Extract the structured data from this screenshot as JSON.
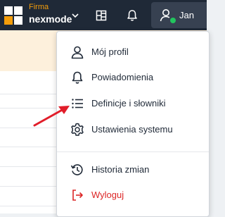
{
  "header": {
    "brand_small": "Firma",
    "brand_name": "nexmode",
    "user_name": "Jan",
    "colors": {
      "bar": "#1f2937",
      "brand_accent": "#f59e0b",
      "online": "#22c55e"
    }
  },
  "menu": {
    "items": [
      {
        "label": "Mój profil",
        "icon": "user-icon"
      },
      {
        "label": "Powiadomienia",
        "icon": "bell-icon"
      },
      {
        "label": "Definicje i słowniki",
        "icon": "list-icon"
      },
      {
        "label": "Ustawienia systemu",
        "icon": "gear-icon"
      },
      {
        "label": "Historia zmian",
        "icon": "history-icon"
      },
      {
        "label": "Wyloguj",
        "icon": "logout-icon"
      }
    ],
    "colors": {
      "danger": "#dc2626",
      "annotation_arrow": "#e11d2a"
    }
  }
}
